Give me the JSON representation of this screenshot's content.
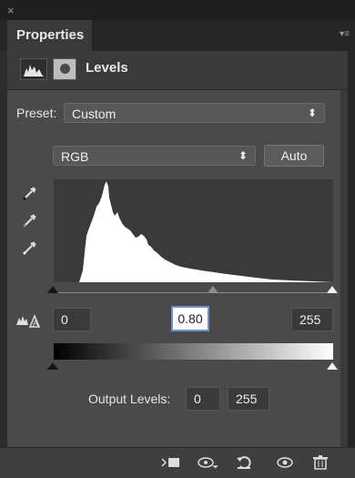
{
  "panel": {
    "close_glyph": "×",
    "tab_label": "Properties",
    "menu_glyph": "▾≡"
  },
  "header": {
    "title": "Levels",
    "icons": [
      "levels-adjustment-icon",
      "mask-icon"
    ]
  },
  "preset": {
    "label": "Preset:",
    "value": "Custom"
  },
  "channel": {
    "value": "RGB",
    "auto_label": "Auto"
  },
  "eyedroppers": [
    "black-point-eyedropper-icon",
    "gray-point-eyedropper-icon",
    "white-point-eyedropper-icon"
  ],
  "input_levels": {
    "black": "0",
    "midtone": "0.80",
    "white": "255"
  },
  "output_levels": {
    "label": "Output Levels:",
    "black": "0",
    "white": "255"
  },
  "bottom_toolbar": [
    "clip-to-layer-icon",
    "view-previous-state-icon",
    "reset-icon",
    "visibility-icon",
    "delete-icon"
  ],
  "colors": {
    "panel_bg": "#4a4a4a",
    "dark_bg": "#2b2b2b",
    "accent_focus": "#6f8fd0"
  }
}
